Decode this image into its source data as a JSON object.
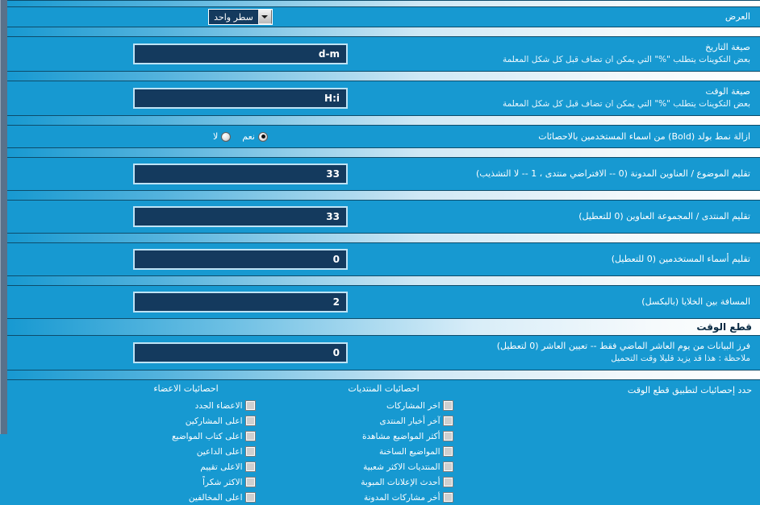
{
  "colors": {
    "background": "#1799d1",
    "input_bg": "#143a5e",
    "input_border": "#bfe3f5",
    "separator_light": "#ffffff",
    "section_header_text": "#0a2b44",
    "gutter": "#59718a"
  },
  "rows": {
    "display": {
      "label": "العرض",
      "select_value": "سطر واحد"
    },
    "date_format": {
      "title": "صيغة التاريخ",
      "desc": "بعض التكوينات يتطلب \"%\" التي يمكن ان تضاف قبل كل شكل المعلمة",
      "value": "d-m"
    },
    "time_format": {
      "title": "صيغة الوقت",
      "desc": "بعض التكوينات يتطلب \"%\" التي يمكن ان تضاف قبل كل شكل المعلمة",
      "value": "H:i"
    },
    "remove_bold": {
      "title": "ازالة نمط بولد (Bold) من اسماء المستخدمين بالاحصائات",
      "options": [
        {
          "label": "نعم",
          "selected": true
        },
        {
          "label": "لا",
          "selected": false
        }
      ]
    },
    "trim_thread_titles": {
      "title": "تقليم الموضوع / العناوين المدونة (0 -- الافتراضي منتدى ، 1 -- لا التشذيب)",
      "value": "33"
    },
    "trim_forum_titles": {
      "title": "تقليم المنتدى / المجموعة العناوين (0 للتعطيل)",
      "value": "33"
    },
    "trim_usernames": {
      "title": "تقليم أسماء المستخدمين (0 للتعطيل)",
      "value": "0"
    },
    "cell_spacing": {
      "title": "المسافة بين الخلايا (بالبكسل)",
      "value": "2"
    },
    "timecut_section": {
      "label": "قطع الوقت"
    },
    "timecut_days": {
      "title": "فرز البيانات من يوم العاشر الماضي فقط -- تعيين العاشر (0 لتعطيل)",
      "desc": "ملاحظة : هذا قد يزيد قليلا وقت التحميل",
      "value": "0"
    },
    "timecut_select": {
      "title": "حدد إحصائيات لتطبيق قطع الوقت"
    }
  },
  "stats": {
    "columns": [
      {
        "header": "احصائيات المنتديات",
        "items": [
          {
            "label": "اخر المشاركات",
            "checked": false
          },
          {
            "label": "آخر أخبار المنتدى",
            "checked": false
          },
          {
            "label": "أكثر المواضيع مشاهدة",
            "checked": false
          },
          {
            "label": "المواضيع الساخنة",
            "checked": false
          },
          {
            "label": "المنتديات الاكثر شعبية",
            "checked": false
          },
          {
            "label": "أحدث الإعلانات المبوبة",
            "checked": false
          },
          {
            "label": "أخر مشاركات المدونة",
            "checked": false
          }
        ]
      },
      {
        "header": "احصائيات الاعضاء",
        "items": [
          {
            "label": "الاعضاء الجدد",
            "checked": false
          },
          {
            "label": "اعلى المشاركين",
            "checked": false
          },
          {
            "label": "اعلى كتاب المواضيع",
            "checked": false
          },
          {
            "label": "اعلى الداعين",
            "checked": false
          },
          {
            "label": "الاعلى تقييم",
            "checked": false
          },
          {
            "label": "الاكثر شكراً",
            "checked": false
          },
          {
            "label": "اعلى المخالفين",
            "checked": false
          }
        ]
      }
    ]
  }
}
